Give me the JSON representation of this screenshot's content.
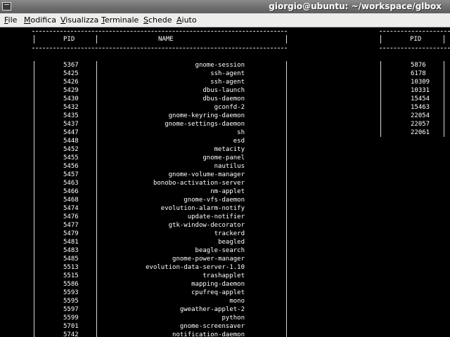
{
  "window": {
    "title": "giorgio@ubuntu: ~/workspace/glbox"
  },
  "menu": [
    "File",
    "Modifica",
    "Visualizza",
    "Terminale",
    "Schede",
    "Aiuto"
  ],
  "left_table": {
    "headers": {
      "pid": "PID",
      "name": "NAME"
    },
    "rows": [
      [
        "5367",
        "gnome-session"
      ],
      [
        "5425",
        "ssh-agent"
      ],
      [
        "5426",
        "ssh-agent"
      ],
      [
        "5429",
        "dbus-launch"
      ],
      [
        "5430",
        "dbus-daemon"
      ],
      [
        "5432",
        "gconfd-2"
      ],
      [
        "5435",
        "gnome-keyring-daemon"
      ],
      [
        "5437",
        "gnome-settings-daemon"
      ],
      [
        "5447",
        "sh"
      ],
      [
        "5448",
        "esd"
      ],
      [
        "5452",
        "metacity"
      ],
      [
        "5455",
        "gnome-panel"
      ],
      [
        "5456",
        "nautilus"
      ],
      [
        "5457",
        "gnome-volume-manager"
      ],
      [
        "5463",
        "bonobo-activation-server"
      ],
      [
        "5466",
        "nm-applet"
      ],
      [
        "5468",
        "gnome-vfs-daemon"
      ],
      [
        "5474",
        "evolution-alarm-notify"
      ],
      [
        "5476",
        "update-notifier"
      ],
      [
        "5477",
        "gtk-window-decorator"
      ],
      [
        "5479",
        "trackerd"
      ],
      [
        "5481",
        "beagled"
      ],
      [
        "5483",
        "beagle-search"
      ],
      [
        "5485",
        "gnome-power-manager"
      ],
      [
        "5513",
        "evolution-data-server-1.10"
      ],
      [
        "5515",
        "trashapplet"
      ],
      [
        "5586",
        "mapping-daemon"
      ],
      [
        "5593",
        "cpufreq-applet"
      ],
      [
        "5595",
        "mono"
      ],
      [
        "5597",
        "gweather-applet-2"
      ],
      [
        "5599",
        "python"
      ],
      [
        "5701",
        "gnome-screensaver"
      ],
      [
        "5742",
        "notification-daemon"
      ]
    ]
  },
  "right_table": {
    "headers": {
      "pid": "PID"
    },
    "rows": [
      "5876",
      "6178",
      "10309",
      "10331",
      "15454",
      "15463",
      "22054",
      "22057",
      "22061"
    ]
  }
}
